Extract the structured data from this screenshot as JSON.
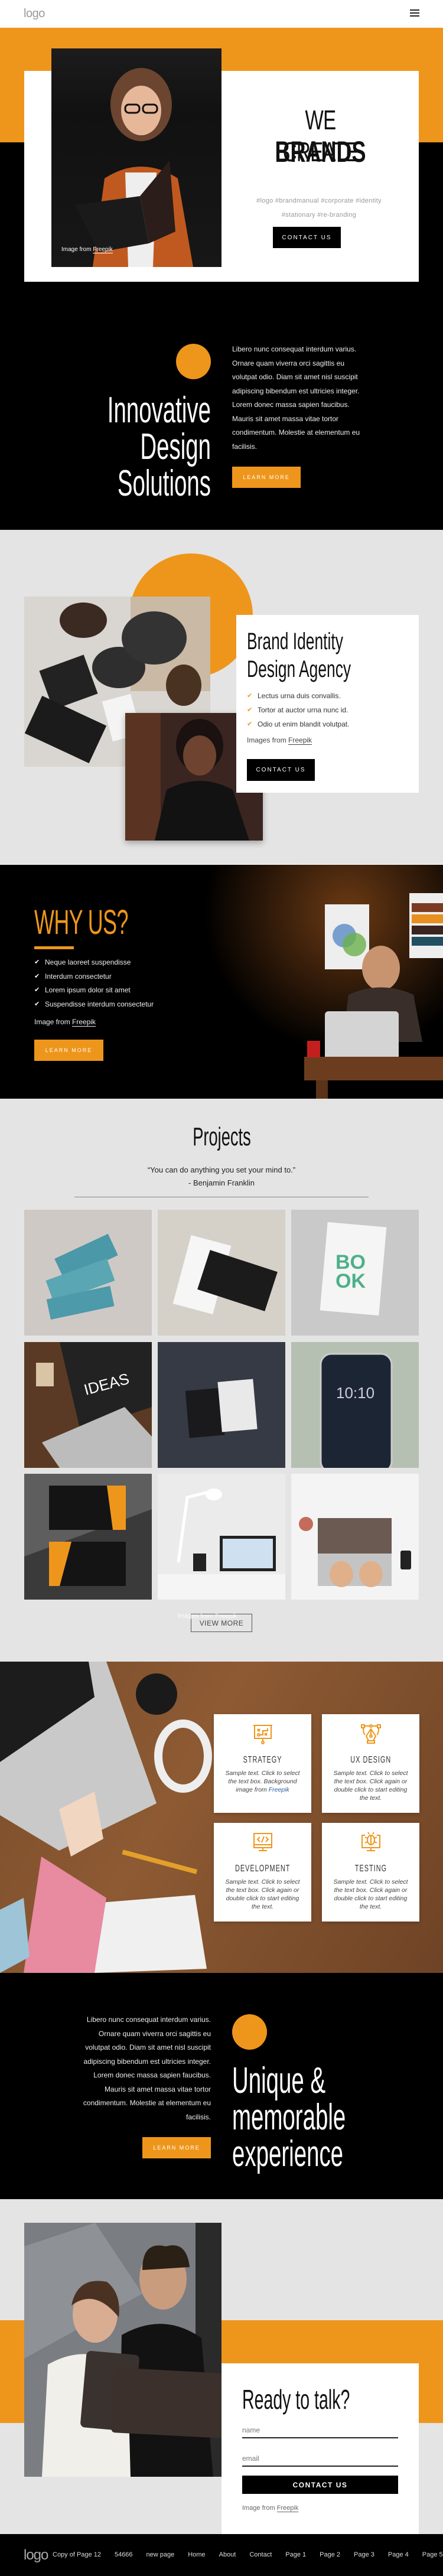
{
  "theme": {
    "accent": "#ee961c",
    "dark": "#000000",
    "light_bg": "#e4e4e4",
    "link": "#2b5c9c"
  },
  "header": {
    "logo": "logo",
    "menu_icon": "hamburger-icon"
  },
  "hero": {
    "title_line1": "WE CREATE",
    "title_line2": "BRANDS",
    "tags": "#logo #brandmanual #corporate #identity #stationary #re-branding",
    "button": "CONTACT US",
    "credit_prefix": "Image from ",
    "credit_link": "Freepik"
  },
  "innovative": {
    "title": [
      "Innovative",
      "Design",
      "Solutions"
    ],
    "paragraph": "Libero nunc consequat interdum varius. Ornare quam viverra orci sagittis eu volutpat odio. Diam sit amet nisl suscipit adipiscing bibendum est ultricies integer. Lorem donec massa sapien faucibus. Mauris sit amet massa vitae tortor condimentum. Molestie at elementum eu facilisis.",
    "button": "LEARN MORE"
  },
  "brand": {
    "title_line1": "Brand Identity",
    "title_line2": "Design Agency",
    "items": [
      "Lectus urna duis convallis.",
      "Tortor at auctor urna nunc id.",
      "Odio ut enim blandit volutpat."
    ],
    "credit_prefix": "Images from ",
    "credit_link": "Freepik",
    "button": "CONTACT US"
  },
  "why": {
    "title": "WHY US?",
    "items": [
      "Neque laoreet suspendisse",
      "Interdum consectetur",
      "Lorem ipsum dolor sit amet",
      "Suspendisse interdum consectetur"
    ],
    "credit_prefix": "Image from ",
    "credit_link": "Freepik",
    "button": "LEARN MORE"
  },
  "projects": {
    "title": "Projects",
    "quote": "“You can do anything you set your mind to.”",
    "author": "- Benjamin Franklin",
    "tiles": [
      "Book covers mockup",
      "Business cards mockup",
      "Hardcover book mockup",
      "Laptop ideas mockup",
      "Vertical business cards",
      "Smartphone mockup",
      "Orange business cards",
      "Desk lamp and laptop",
      "Hands typing on laptop"
    ],
    "credit": "Images from Freepik",
    "button": "VIEW MORE"
  },
  "services": {
    "cards": [
      {
        "title": "STRATEGY",
        "text": "Sample text. Click to select the text box.  Background image from ",
        "link": "Freepik",
        "icon": "strategy-board-icon"
      },
      {
        "title": "UX DESIGN",
        "text": "Sample text. Click to select the text box. Click again or double click to start editing the text.",
        "link": "",
        "icon": "pen-tool-icon"
      },
      {
        "title": "DEVELOPMENT",
        "text": "Sample text. Click to select the text box. Click again or double click to start editing the text.",
        "link": "",
        "icon": "code-monitor-icon"
      },
      {
        "title": "TESTING",
        "text": "Sample text. Click to select the text box. Click again or double click to start editing the text.",
        "link": "",
        "icon": "bug-monitor-icon"
      }
    ]
  },
  "unique": {
    "paragraph": "Libero nunc consequat interdum varius. Ornare quam viverra orci sagittis eu volutpat odio. Diam sit amet nisl suscipit adipiscing bibendum est ultricies integer. Lorem donec massa sapien faucibus. Mauris sit amet massa vitae tortor condimentum. Molestie at elementum eu facilisis.",
    "button": "LEARN MORE",
    "title": [
      "Unique &",
      "memorable",
      "experience"
    ]
  },
  "contact": {
    "title": "Ready to talk?",
    "name_placeholder": "name",
    "email_placeholder": "email",
    "button": "CONTACT US",
    "credit_prefix": "Image from ",
    "credit_link": "Freepik"
  },
  "footer": {
    "logo": "logo",
    "nav": [
      "Copy of Page 12",
      "54666",
      "new page",
      "Home",
      "About",
      "Contact",
      "Page 1",
      "Page 2",
      "Page 3",
      "Page 4",
      "Page 5"
    ]
  }
}
